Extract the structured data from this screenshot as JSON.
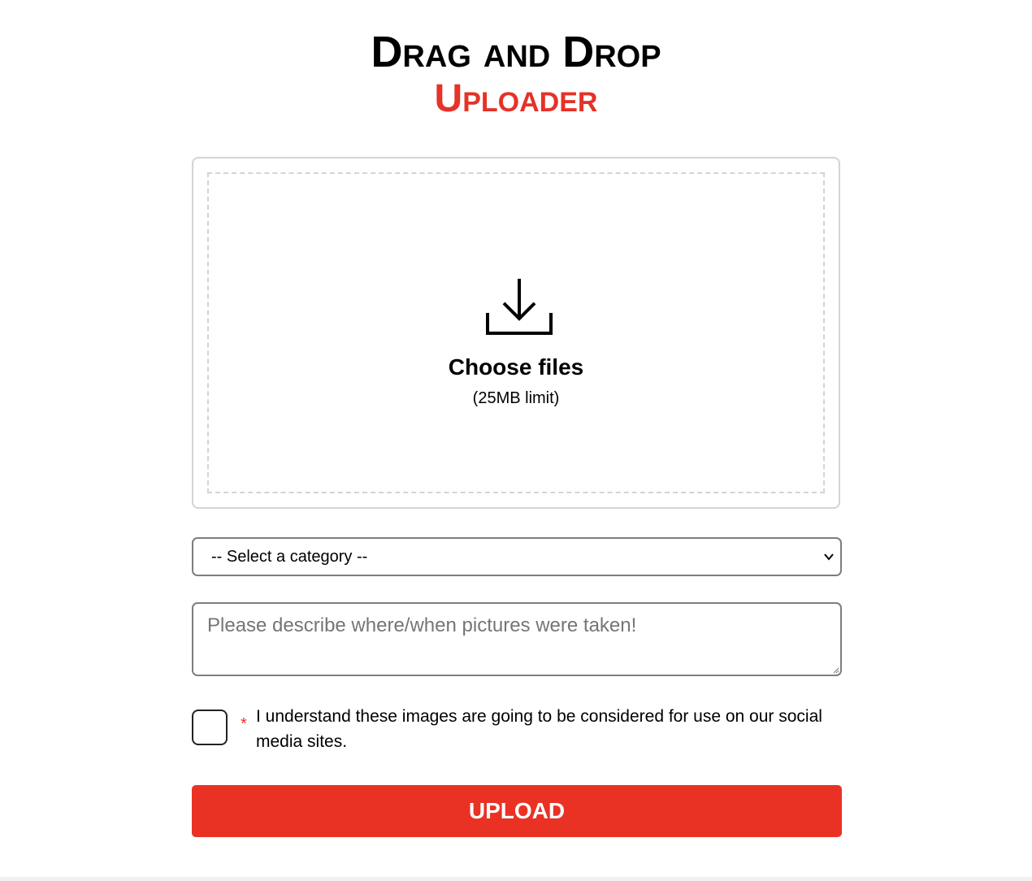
{
  "title": {
    "line1": "Drag and Drop",
    "line2": "Uploader"
  },
  "dropzone": {
    "icon": "download-icon",
    "choose_label": "Choose files",
    "limit_label": "(25MB limit)"
  },
  "category": {
    "selected": "-- Select a category --",
    "icon": "chevron-down-icon"
  },
  "description": {
    "placeholder": "Please describe where/when pictures were taken!"
  },
  "consent": {
    "required_mark": "*",
    "label": "I understand these images are going to be considered for use on our social media sites."
  },
  "upload_button": {
    "label": "UPLOAD"
  },
  "colors": {
    "accent": "#e63228",
    "border": "#d4d4d4",
    "input_border": "#7e7e7e"
  }
}
